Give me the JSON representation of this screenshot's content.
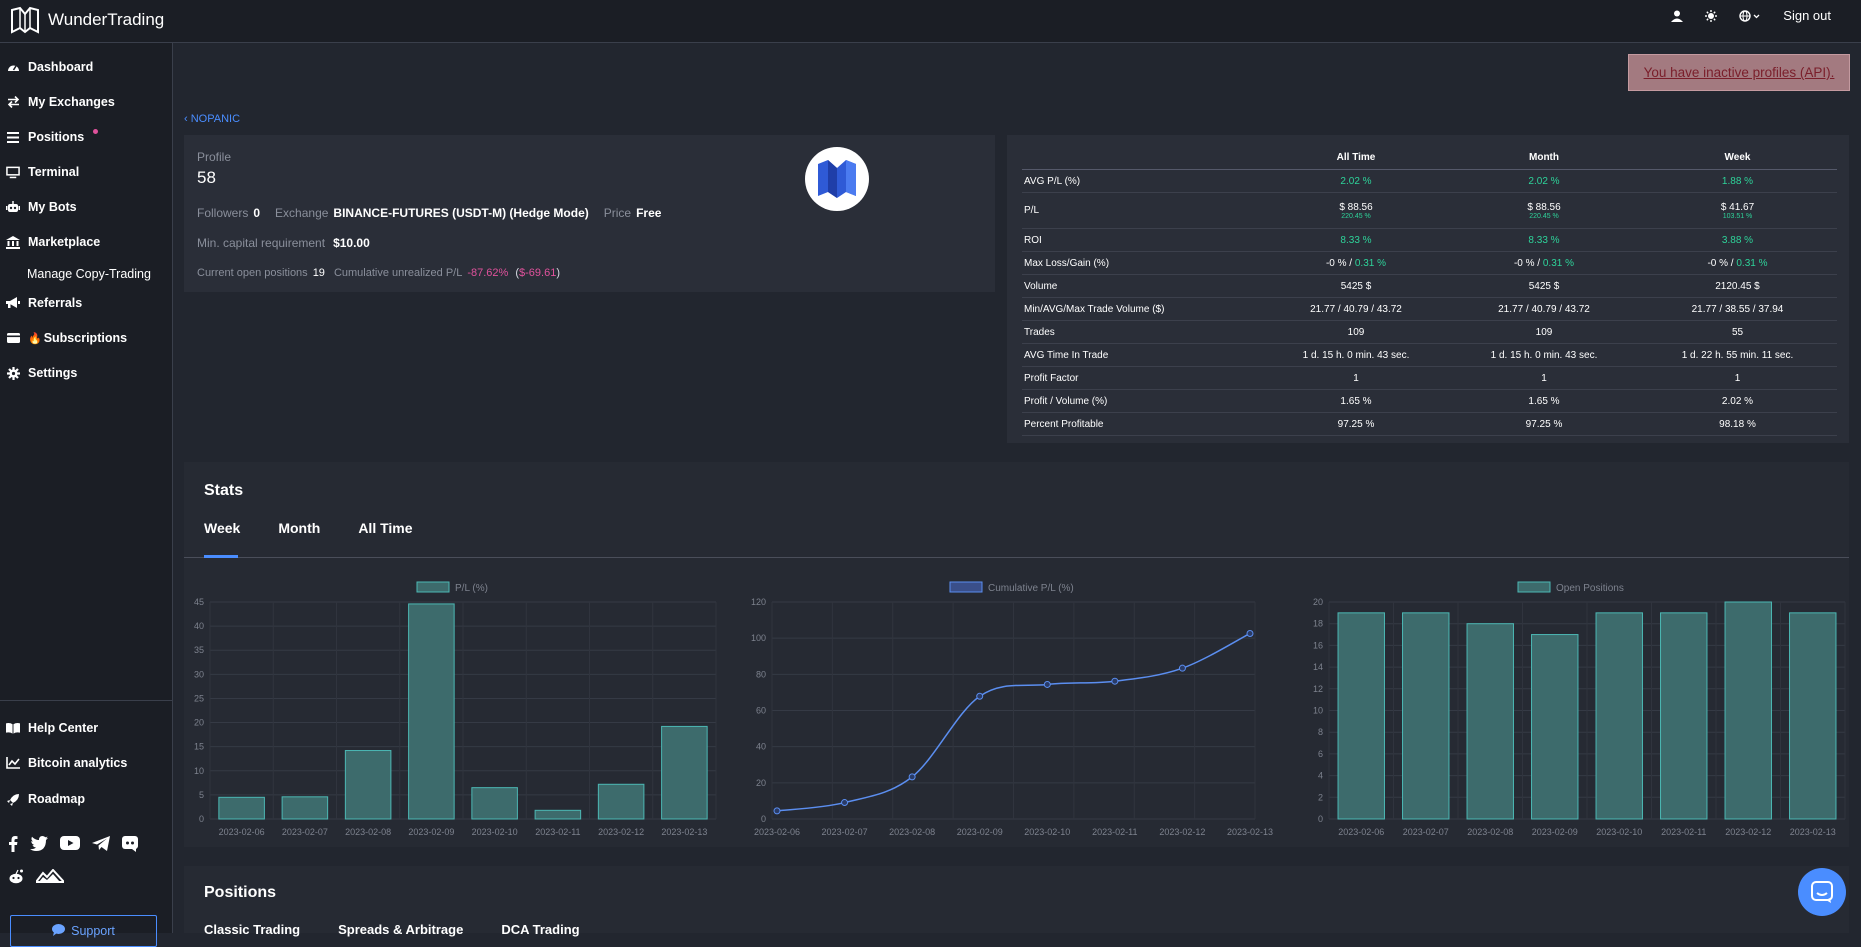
{
  "app": {
    "title": "WunderTrading"
  },
  "topbar": {
    "sign_out": "Sign out"
  },
  "sidebar": {
    "items": [
      {
        "label": "Dashboard"
      },
      {
        "label": "My Exchanges"
      },
      {
        "label": "Positions"
      },
      {
        "label": "Terminal"
      },
      {
        "label": "My Bots"
      },
      {
        "label": "Marketplace"
      },
      {
        "label": "Manage Copy-Trading"
      },
      {
        "label": "Referrals"
      },
      {
        "label": "Subscriptions"
      },
      {
        "label": "Settings"
      }
    ],
    "bottom_items": [
      {
        "label": "Help Center"
      },
      {
        "label": "Bitcoin analytics"
      },
      {
        "label": "Roadmap"
      }
    ],
    "support": "Support"
  },
  "alert": {
    "text": "You have inactive profiles (API)."
  },
  "back_link": "NOPANIC",
  "profile": {
    "profile_label": "Profile",
    "profile_value": "58",
    "followers_label": "Followers",
    "followers_value": "0",
    "exchange_label": "Exchange",
    "exchange_value": "BINANCE-FUTURES (USDT-M) (Hedge Mode)",
    "price_label": "Price",
    "price_value": "Free",
    "min_capital_label": "Min. capital requirement",
    "min_capital_value": "$10.00",
    "open_positions_label": "Current open positions",
    "open_positions_value": "19",
    "unrealized_label": "Cumulative unrealized P/L",
    "unrealized_pct": "-87.62%",
    "unrealized_open": "(",
    "unrealized_usd": "$-69.61",
    "unrealized_close": ")"
  },
  "stats_table": {
    "headers": [
      "",
      "All Time",
      "Month",
      "Week"
    ],
    "rows": [
      {
        "label": "AVG P/L (%)",
        "cells": [
          "2.02 %",
          "2.02 %",
          "1.88 %"
        ]
      },
      {
        "label": "P/L",
        "cells": [
          "$ 88.56",
          "$ 88.56",
          "$ 41.67"
        ],
        "sub": [
          "220.45 %",
          "220.45 %",
          "103.51 %"
        ]
      },
      {
        "label": "ROI",
        "cells": [
          "8.33 %",
          "8.33 %",
          "3.88 %"
        ]
      },
      {
        "label": "Max Loss/Gain (%)",
        "cells": [
          "-0 % / ",
          "-0 % / ",
          "-0 % / "
        ],
        "gain": [
          "0.31 %",
          "0.31 %",
          "0.31 %"
        ]
      },
      {
        "label": "Volume",
        "cells": [
          "5425 $",
          "5425 $",
          "2120.45 $"
        ]
      },
      {
        "label": "Min/AVG/Max Trade Volume ($)",
        "cells": [
          "21.77 / 40.79 / 43.72",
          "21.77 / 40.79 / 43.72",
          "21.77 / 38.55 / 37.94"
        ]
      },
      {
        "label": "Trades",
        "cells": [
          "109",
          "109",
          "55"
        ]
      },
      {
        "label": "AVG Time In Trade",
        "cells": [
          "1 d. 15 h. 0 min. 43 sec.",
          "1 d. 15 h. 0 min. 43 sec.",
          "1 d. 22 h. 55 min. 11 sec."
        ]
      },
      {
        "label": "Profit Factor",
        "cells": [
          "1",
          "1",
          "1"
        ]
      },
      {
        "label": "Profit / Volume (%)",
        "cells": [
          "1.65 %",
          "1.65 %",
          "2.02 %"
        ]
      },
      {
        "label": "Percent Profitable",
        "cells": [
          "97.25 %",
          "97.25 %",
          "98.18 %"
        ]
      }
    ]
  },
  "stats": {
    "title": "Stats",
    "tabs": [
      "Week",
      "Month",
      "All Time"
    ]
  },
  "positions": {
    "title": "Positions",
    "tabs": [
      "Classic Trading",
      "Spreads & Arbitrage",
      "DCA Trading"
    ]
  },
  "colors": {
    "green": "#2ed39a",
    "pink": "#e0529c",
    "accent": "#4a8dff",
    "bar_teal": "#3d6b6c",
    "bar_stroke": "#4cb8b4",
    "line_blue": "#5b8ef0"
  },
  "chart_data": [
    {
      "type": "bar",
      "legend": "P/L (%)",
      "categories": [
        "2023-02-06",
        "2023-02-07",
        "2023-02-08",
        "2023-02-09",
        "2023-02-10",
        "2023-02-11",
        "2023-02-12",
        "2023-02-13"
      ],
      "values": [
        4.5,
        4.6,
        14.2,
        44.6,
        6.5,
        1.8,
        7.2,
        19.2
      ],
      "ylim": [
        0,
        45
      ],
      "yticks": [
        0,
        5,
        10,
        15,
        20,
        25,
        30,
        35,
        40,
        45
      ]
    },
    {
      "type": "line",
      "legend": "Cumulative P/L (%)",
      "categories": [
        "2023-02-06",
        "2023-02-07",
        "2023-02-08",
        "2023-02-09",
        "2023-02-10",
        "2023-02-11",
        "2023-02-12",
        "2023-02-13"
      ],
      "values": [
        4.5,
        9.1,
        23.3,
        67.9,
        74.4,
        76.2,
        83.4,
        102.6
      ],
      "ylim": [
        0,
        120
      ],
      "yticks": [
        0,
        20,
        40,
        60,
        80,
        100,
        120
      ]
    },
    {
      "type": "bar",
      "legend": "Open Positions",
      "categories": [
        "2023-02-06",
        "2023-02-07",
        "2023-02-08",
        "2023-02-09",
        "2023-02-10",
        "2023-02-11",
        "2023-02-12",
        "2023-02-13"
      ],
      "values": [
        19,
        19,
        18,
        17,
        19,
        19,
        20,
        19
      ],
      "ylim": [
        0,
        20
      ],
      "yticks": [
        0,
        2,
        4,
        6,
        8,
        10,
        12,
        14,
        16,
        18,
        20
      ]
    }
  ]
}
